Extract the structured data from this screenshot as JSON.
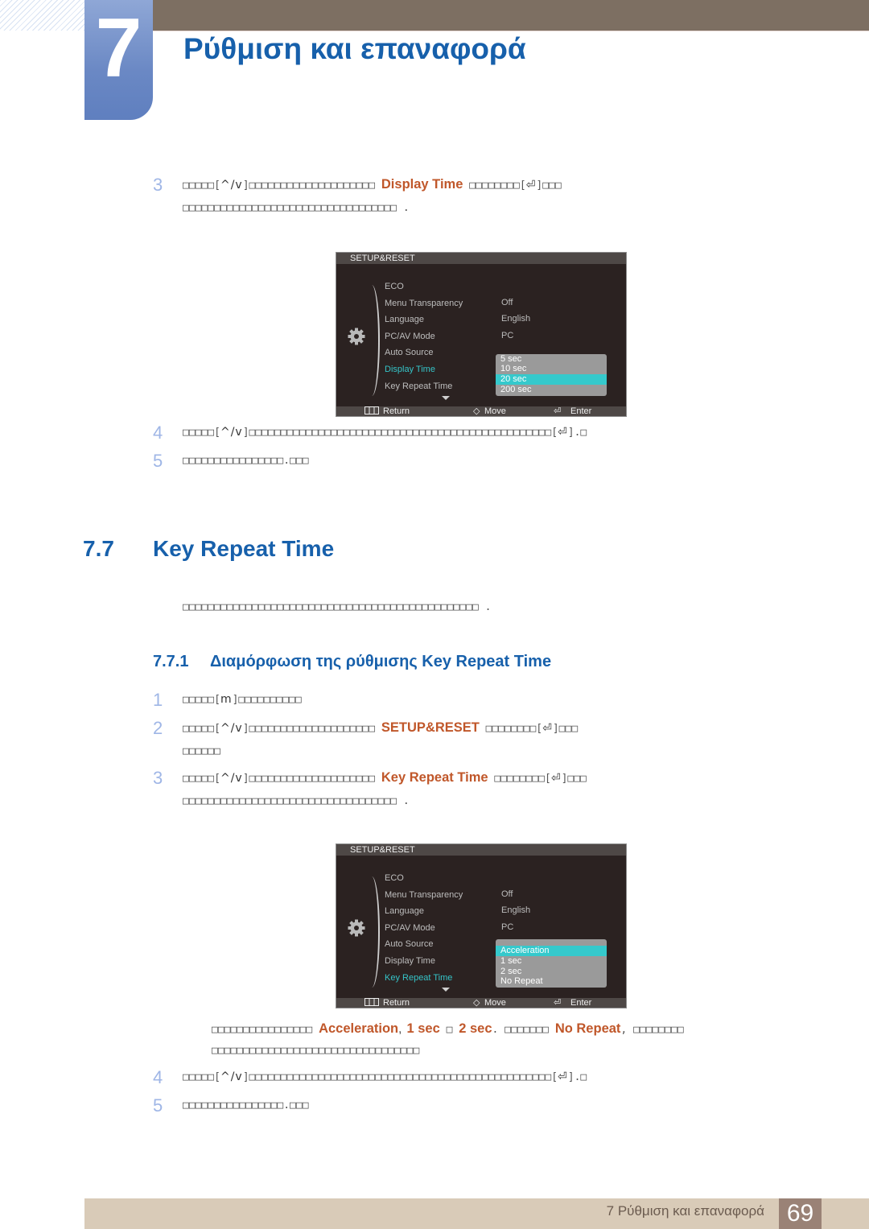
{
  "header": {
    "chapter_number": "7",
    "chapter_title": "Ρύθμιση και επαναφορά"
  },
  "colors": {
    "heading_blue": "#1760ab",
    "highlight_orange": "#c0572a",
    "step_number": "#9fb6e6",
    "osd_selection": "#35c9cc",
    "footer_bg": "#d9cbb8",
    "page_badge": "#9a8276"
  },
  "top_steps": [
    {
      "num": "3",
      "pre": "□□□□□[",
      "key": "^/v",
      "mid": "]□□□□□□□□□□□□□□□□□□□□ ",
      "hl": "Display Time",
      "post": " □□□□□□□□[",
      "key2": "⏎",
      "end": "]□□□",
      "line2": "□□□□□□□□□□□□□□□□□□□□□□□□□□□□□□□□□□ ."
    },
    {
      "num": "4",
      "pre": "□□□□□[",
      "key": "^/v",
      "mid": "]□□□□□□□□□□□□□□□□□□□□□□□□□□□□□□□□□□□□□□□□□□□□□□□□[",
      "key2": "⏎",
      "end": "].□"
    },
    {
      "num": "5",
      "text": "□□□□□□□□□□□□□□□□.□□□"
    }
  ],
  "osd1": {
    "title": "SETUP&RESET",
    "items": [
      "ECO",
      "Menu Transparency",
      "Language",
      "PC/AV Mode",
      "Auto Source",
      "Display Time",
      "Key Repeat Time"
    ],
    "active_item": "Display Time",
    "values": [
      "Off",
      "English",
      "PC"
    ],
    "options": [
      "5 sec",
      "10 sec",
      "20 sec",
      "200 sec"
    ],
    "selected_option": "20 sec",
    "footer": {
      "return": "Return",
      "move": "Move",
      "enter": "Enter"
    }
  },
  "section": {
    "number": "7.7",
    "title": "Key Repeat Time",
    "intro": "□□□□□□□□□□□□□□□□□□□□□□□□□□□□□□□□□□□□□□□□□□□□□□□ .",
    "sub_number": "7.7.1",
    "sub_title": "Διαμόρφωση της ρύθμισης Key Repeat Time"
  },
  "steps": [
    {
      "num": "1",
      "pre": "□□□□□[",
      "key": "m",
      "end": "]□□□□□□□□□□"
    },
    {
      "num": "2",
      "pre": "□□□□□[",
      "key": "^/v",
      "mid": "]□□□□□□□□□□□□□□□□□□□□ ",
      "hl": "SETUP&RESET",
      "post": " □□□□□□□□[",
      "key2": "⏎",
      "end": "]□□□",
      "line2": "□□□□□□"
    },
    {
      "num": "3",
      "pre": "□□□□□[",
      "key": "^/v",
      "mid": "]□□□□□□□□□□□□□□□□□□□□ ",
      "hl": "Key Repeat Time",
      "post": " □□□□□□□□[",
      "key2": "⏎",
      "end": "]□□□",
      "line2": "□□□□□□□□□□□□□□□□□□□□□□□□□□□□□□□□□□ ."
    },
    {
      "num": "4",
      "pre": "□□□□□[",
      "key": "^/v",
      "mid": "]□□□□□□□□□□□□□□□□□□□□□□□□□□□□□□□□□□□□□□□□□□□□□□□□[",
      "key2": "⏎",
      "end": "].□"
    },
    {
      "num": "5",
      "text": "□□□□□□□□□□□□□□□□.□□□"
    }
  ],
  "osd2": {
    "title": "SETUP&RESET",
    "items": [
      "ECO",
      "Menu Transparency",
      "Language",
      "PC/AV Mode",
      "Auto Source",
      "Display Time",
      "Key Repeat Time"
    ],
    "active_item": "Key Repeat Time",
    "values": [
      "Off",
      "English",
      "PC"
    ],
    "options": [
      "Acceleration",
      "1 sec",
      "2 sec",
      "No Repeat"
    ],
    "selected_option": "Acceleration",
    "footer": {
      "return": "Return",
      "move": "Move",
      "enter": "Enter"
    }
  },
  "note": {
    "pre": "□□□□□□□□□□□□□□□□ ",
    "hl1": "Acceleration",
    "sep1": ", ",
    "hl2": "1 sec",
    "sep2": " □ ",
    "hl3": "2 sec",
    "mid": ". □□□□□□□ ",
    "hl4": "No Repeat",
    "end": ", □□□□□□□□",
    "line2": "□□□□□□□□□□□□□□□□□□□□□□□□□□□□□□□□□"
  },
  "footer": {
    "text": "7 Ρύθμιση και επαναφορά",
    "page_number": "69"
  }
}
